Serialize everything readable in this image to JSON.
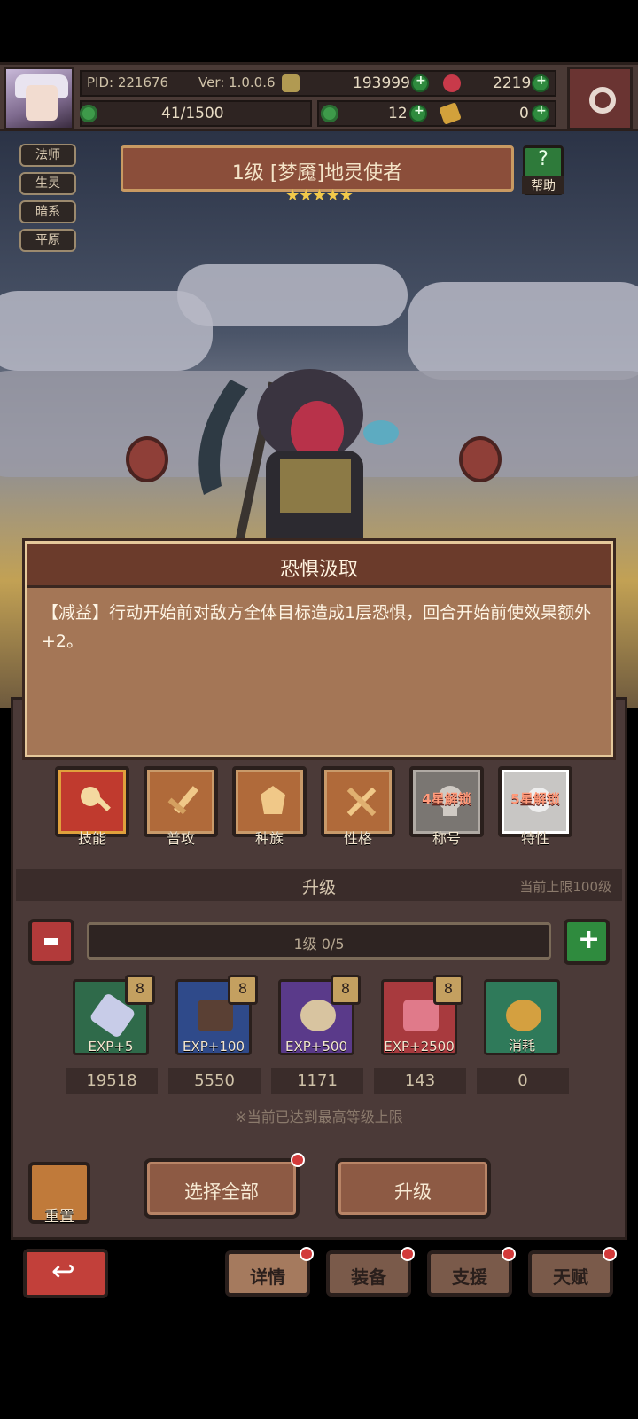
{
  "hud": {
    "pid": "PID: 221676",
    "version": "Ver: 1.0.0.6",
    "gold": "193999",
    "gems": "2219",
    "stamina": "41/1500",
    "clovers": "12",
    "stamps": "0"
  },
  "hero": {
    "tags": [
      "法师",
      "生灵",
      "暗系",
      "平原"
    ],
    "name": "1级 [梦魇]地灵使者",
    "stars": "★★★★★",
    "help_label": "帮助"
  },
  "popup": {
    "title": "恐惧汲取",
    "text": "【减益】行动开始前对敌方全体目标造成1层恐惧，回合开始前使效果额外+2。"
  },
  "tabs": [
    {
      "label": "技能",
      "lock": ""
    },
    {
      "label": "普攻",
      "lock": ""
    },
    {
      "label": "种族",
      "lock": ""
    },
    {
      "label": "性格",
      "lock": ""
    },
    {
      "label": "称号",
      "lock": "4星解锁"
    },
    {
      "label": "特性",
      "lock": "5星解锁"
    }
  ],
  "upgrade": {
    "title": "升级",
    "limit": "当前上限100级",
    "level_progress": "1级  0/5",
    "items": [
      {
        "exp": "EXP+5",
        "count": "19518",
        "badge": "8"
      },
      {
        "exp": "EXP+100",
        "count": "5550",
        "badge": "8"
      },
      {
        "exp": "EXP+500",
        "count": "1171",
        "badge": "8"
      },
      {
        "exp": "EXP+2500",
        "count": "143",
        "badge": "8"
      },
      {
        "exp": "消耗",
        "count": "0",
        "badge": ""
      }
    ],
    "max_note": "※当前已达到最高等级上限"
  },
  "actions": {
    "reset": "重置",
    "select_all": "选择全部",
    "upgrade": "升级"
  },
  "nav": [
    "详情",
    "装备",
    "支援",
    "天赋"
  ],
  "colors": {
    "panel": "#4b3a38",
    "popup": "#a47656",
    "accent_red": "#c2403a",
    "accent_green": "#2f8b3e"
  }
}
